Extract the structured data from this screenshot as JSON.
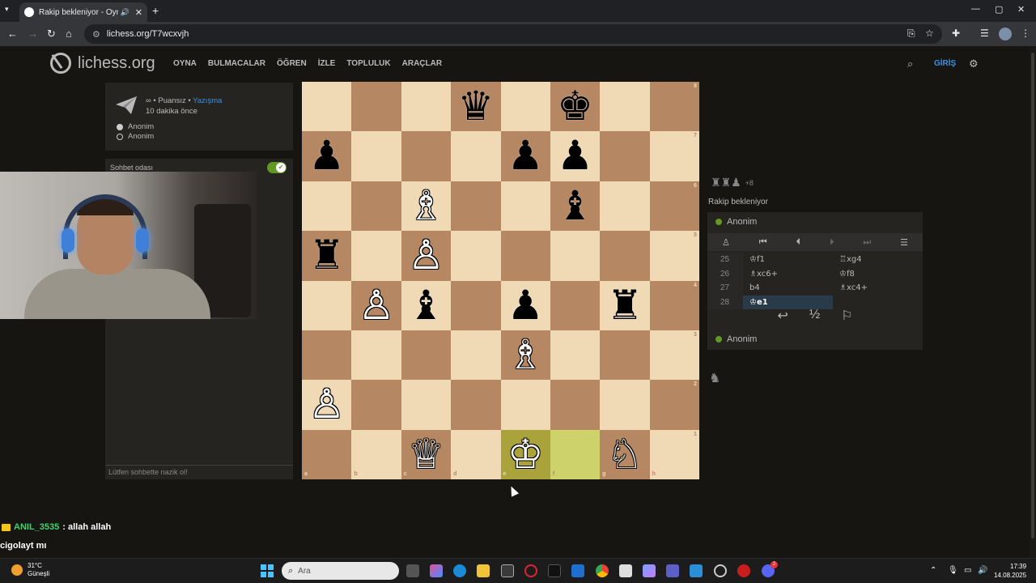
{
  "browser": {
    "tab_title": "Rakip bekleniyor - Oyna Anonim",
    "url": "lichess.org/T7wcxvjh",
    "icons": [
      "tab-menu-icon",
      "close-icon",
      "plus-icon",
      "minimize-icon",
      "maximize-icon",
      "back-icon",
      "forward-icon",
      "reload-icon",
      "home-icon",
      "install-icon",
      "star-icon",
      "extensions-icon",
      "reading-list-icon",
      "profile-icon",
      "kebab-menu-icon"
    ]
  },
  "lichess": {
    "logo_text": "lichess.org",
    "nav": [
      "OYNA",
      "BULMACALAR",
      "ÖĞREN",
      "İZLE",
      "TOPLULUK",
      "ARAÇLAR"
    ],
    "signin": "GİRİŞ"
  },
  "game_info": {
    "mode_prefix": "∞ • Puansız • ",
    "mode_link": "Yazışma",
    "time_ago": "10 dakika önce",
    "players": [
      "Anonim",
      "Anonim"
    ]
  },
  "chat": {
    "room_label": "Sohbet odası",
    "placeholder": "Lütfen sohbette nazik ol!"
  },
  "board": {
    "files": [
      "a",
      "b",
      "c",
      "d",
      "e",
      "f",
      "g",
      "h"
    ],
    "ranks": [
      "8",
      "7",
      "6",
      "5",
      "4",
      "3",
      "2",
      "1"
    ],
    "highlight": [
      "e1",
      "f1"
    ],
    "pieces": [
      {
        "sq": "d8",
        "glyph": "♛",
        "color": "black"
      },
      {
        "sq": "f8",
        "glyph": "♚",
        "color": "black"
      },
      {
        "sq": "a7",
        "glyph": "♟",
        "color": "black"
      },
      {
        "sq": "e7",
        "glyph": "♟",
        "color": "black"
      },
      {
        "sq": "f7",
        "glyph": "♟",
        "color": "black"
      },
      {
        "sq": "c6",
        "glyph": "♗",
        "color": "white"
      },
      {
        "sq": "f6",
        "glyph": "♝",
        "color": "black"
      },
      {
        "sq": "a5",
        "glyph": "♜",
        "color": "black"
      },
      {
        "sq": "c5",
        "glyph": "♙",
        "color": "white"
      },
      {
        "sq": "b4",
        "glyph": "♙",
        "color": "white"
      },
      {
        "sq": "c4",
        "glyph": "♝",
        "color": "black"
      },
      {
        "sq": "e4",
        "glyph": "♟",
        "color": "black"
      },
      {
        "sq": "g4",
        "glyph": "♜",
        "color": "black"
      },
      {
        "sq": "e3",
        "glyph": "♗",
        "color": "white"
      },
      {
        "sq": "a2",
        "glyph": "♙",
        "color": "white"
      },
      {
        "sq": "c1",
        "glyph": "♕",
        "color": "white"
      },
      {
        "sq": "e1",
        "glyph": "♔",
        "color": "white"
      },
      {
        "sq": "g1",
        "glyph": "♘",
        "color": "white"
      }
    ]
  },
  "right_panel": {
    "captured_glyphs": "♜♜♟",
    "advantage": "+8",
    "status": "Rakip bekleniyor",
    "top_player": "Anonim",
    "bottom_player": "Anonim",
    "moves": [
      {
        "num": "25",
        "white": "♔f1",
        "black": "♖xg4"
      },
      {
        "num": "26",
        "white": "♗xc6+",
        "black": "♔f8"
      },
      {
        "num": "27",
        "white": "b4",
        "black": "♗xc4+"
      },
      {
        "num": "28",
        "white": "♔e1",
        "black": ""
      }
    ],
    "draw_label": "½"
  },
  "stream_chat": {
    "user": "ANIL_3535",
    "message": ": allah allah",
    "line2": "cigolayt mı"
  },
  "taskbar": {
    "temp": "31°C",
    "weather": "Güneşli",
    "search_placeholder": "Ara",
    "time": "17:39",
    "date": "14.08.2025",
    "notification_badge": "2"
  }
}
